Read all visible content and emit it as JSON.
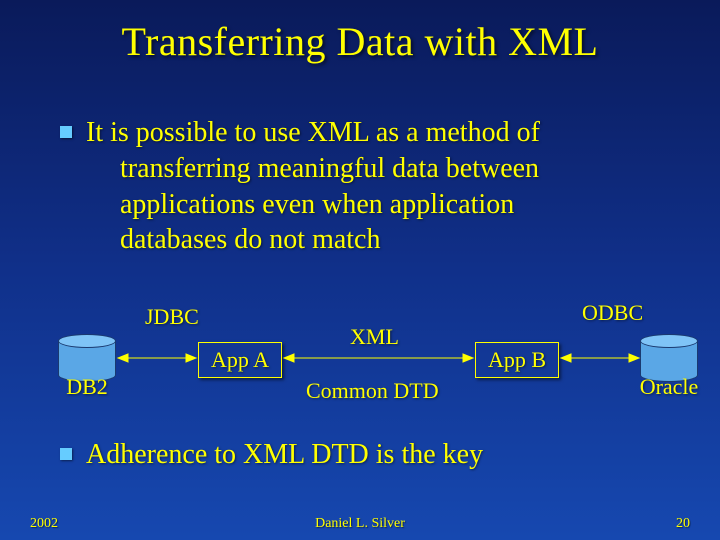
{
  "title": "Transferring Data with XML",
  "bullets": {
    "b1_line1": "It is possible to use XML as a method of",
    "b1_line2": "transferring meaningful data between",
    "b1_line3": "applications even when application",
    "b1_line4": "databases do not match",
    "b2": "Adherence to XML DTD is the key"
  },
  "diagram": {
    "db_left": "DB2",
    "conn_left": "JDBC",
    "app_left": "App A",
    "mid_top": "XML",
    "mid_bottom": "Common DTD",
    "app_right": "App B",
    "conn_right": "ODBC",
    "db_right": "Oracle"
  },
  "footer": {
    "year": "2002",
    "author": "Daniel L. Silver",
    "page": "20"
  }
}
